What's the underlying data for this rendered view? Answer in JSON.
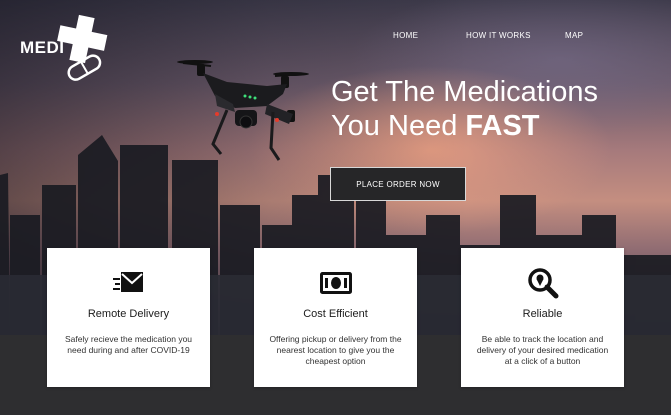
{
  "logo": {
    "text": "MEDI",
    "icon": "medical-cross-pill-icon"
  },
  "nav": {
    "home": "HOME",
    "how_it_works": "HOW IT WORKS",
    "map": "MAP"
  },
  "hero": {
    "line1": "Get The Medications",
    "line2_prefix": "You Need ",
    "line2_emphasis": "FAST",
    "cta_label": "PLACE ORDER NOW"
  },
  "features": [
    {
      "icon": "envelope-delivery-icon",
      "title": "Remote Delivery",
      "text": "Safely recieve the medication you need during and after COVID-19"
    },
    {
      "icon": "cash-icon",
      "title": "Cost Efficient",
      "text": "Offering pickup or delivery from the nearest location to give you the cheapest option"
    },
    {
      "icon": "magnifier-location-icon",
      "title": "Reliable",
      "text": "Be able to track the location and delivery of your desired medication at a click of a button"
    }
  ],
  "colors": {
    "card_bg": "#ffffff",
    "button_bg": "#262628",
    "band_bg": "#2e2e30",
    "text_white": "#ffffff"
  }
}
